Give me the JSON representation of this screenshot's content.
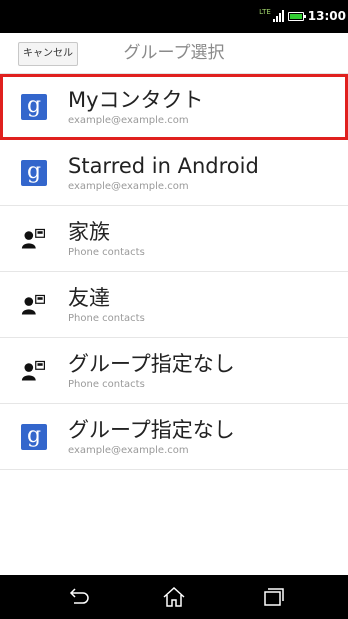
{
  "status_bar": {
    "network_label": "LTE",
    "time": "13:00",
    "battery_color": "#33cc33"
  },
  "header": {
    "cancel_label": "キャンセル",
    "title": "グループ選択"
  },
  "groups": [
    {
      "title": "Myコンタクト",
      "subtitle": "example@example.com",
      "icon": "google-icon",
      "selected": true
    },
    {
      "title": "Starred in Android",
      "subtitle": "example@example.com",
      "icon": "google-icon",
      "selected": false
    },
    {
      "title": "家族",
      "subtitle": "Phone contacts",
      "icon": "phone-contact-icon",
      "selected": false
    },
    {
      "title": "友達",
      "subtitle": "Phone contacts",
      "icon": "phone-contact-icon",
      "selected": false
    },
    {
      "title": "グループ指定なし",
      "subtitle": "Phone contacts",
      "icon": "phone-contact-icon",
      "selected": false
    },
    {
      "title": "グループ指定なし",
      "subtitle": "example@example.com",
      "icon": "google-icon",
      "selected": false
    }
  ],
  "google_icon_letter": "g",
  "colors": {
    "selection_outline": "#e0201e",
    "google_blue": "#3366cc"
  },
  "nav_bar": {
    "icons": [
      "back-icon",
      "home-icon",
      "recent-apps-icon"
    ]
  }
}
